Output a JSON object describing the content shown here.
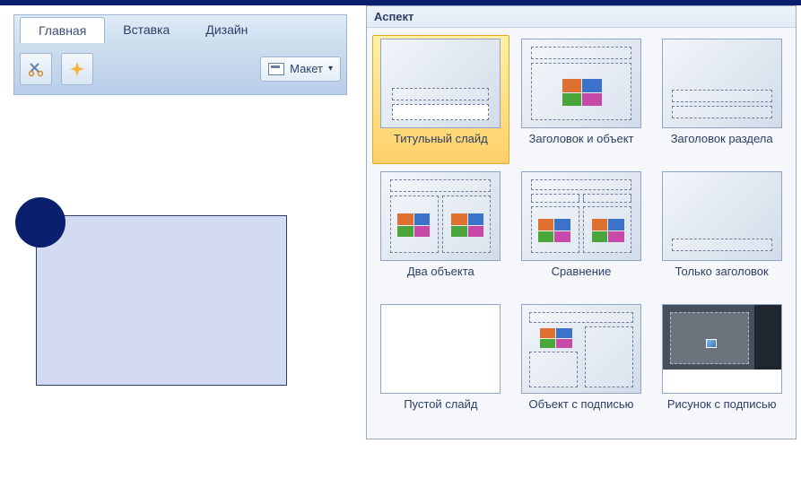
{
  "ribbon": {
    "tabs": [
      "Главная",
      "Вставка",
      "Дизайн"
    ],
    "active_tab_index": 0,
    "layout_button": "Макет"
  },
  "gallery": {
    "title": "Аспект",
    "selected_index": 0,
    "layouts": [
      "Титульный слайд",
      "Заголовок и объект",
      "Заголовок раздела",
      "Два объекта",
      "Сравнение",
      "Только заголовок",
      "Пустой слайд",
      "Объект с подписью",
      "Рисунок с подписью"
    ]
  },
  "canvas": {
    "shapes": [
      {
        "type": "rectangle",
        "fill": "#d3dbf3",
        "outline": "#2b3f66"
      },
      {
        "type": "circle",
        "fill": "#0a1f6e"
      }
    ]
  }
}
